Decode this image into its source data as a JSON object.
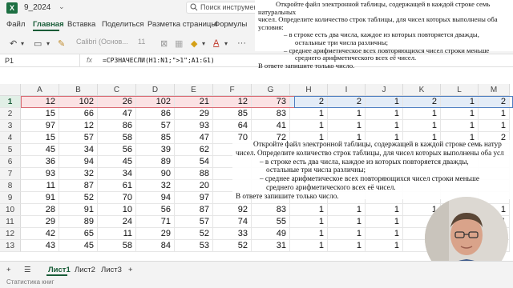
{
  "titlebar": {
    "app_icon": "X",
    "file_name": "9_2024",
    "search_placeholder": "Поиск инструмент"
  },
  "tabs": [
    "Файл",
    "Главная",
    "Вставка",
    "Поделиться",
    "Разметка страницы",
    "Формулы"
  ],
  "toolbar": {
    "font_name": "Calibri (Основ...",
    "font_size": "11"
  },
  "formula_bar": {
    "name_box": "P1",
    "fx": "fx",
    "formula": "=СРЗНАЧЕСЛИ(H1:N1;\">1\";A1:G1)"
  },
  "columns": [
    "A",
    "B",
    "C",
    "D",
    "E",
    "F",
    "G",
    "H",
    "I",
    "J",
    "K",
    "L",
    "M"
  ],
  "rows": [
    {
      "n": "1",
      "v": [
        "12",
        "102",
        "26",
        "102",
        "21",
        "12",
        "73",
        "2",
        "2",
        "1",
        "2",
        "1",
        "2"
      ]
    },
    {
      "n": "2",
      "v": [
        "15",
        "66",
        "47",
        "86",
        "29",
        "85",
        "83",
        "1",
        "1",
        "1",
        "1",
        "1",
        "1"
      ]
    },
    {
      "n": "3",
      "v": [
        "97",
        "12",
        "86",
        "57",
        "93",
        "64",
        "41",
        "1",
        "1",
        "1",
        "1",
        "1",
        "1"
      ]
    },
    {
      "n": "4",
      "v": [
        "15",
        "57",
        "58",
        "85",
        "47",
        "70",
        "72",
        "1",
        "1",
        "1",
        "1",
        "1",
        "2"
      ]
    },
    {
      "n": "5",
      "v": [
        "45",
        "34",
        "56",
        "39",
        "62",
        "",
        "",
        "",
        "",
        "",
        "",
        "",
        ""
      ]
    },
    {
      "n": "6",
      "v": [
        "36",
        "94",
        "45",
        "89",
        "54",
        "",
        "",
        "",
        "",
        "",
        "",
        "",
        ""
      ]
    },
    {
      "n": "7",
      "v": [
        "93",
        "32",
        "34",
        "90",
        "88",
        "",
        "",
        "",
        "",
        "",
        "",
        "",
        ""
      ]
    },
    {
      "n": "8",
      "v": [
        "11",
        "87",
        "61",
        "32",
        "20",
        "",
        "",
        "",
        "",
        "",
        "",
        "",
        ""
      ]
    },
    {
      "n": "9",
      "v": [
        "91",
        "52",
        "70",
        "94",
        "97",
        "",
        "",
        "",
        "",
        "",
        "",
        "",
        ""
      ]
    },
    {
      "n": "10",
      "v": [
        "28",
        "91",
        "10",
        "56",
        "87",
        "92",
        "83",
        "1",
        "1",
        "1",
        "1",
        "1",
        "1"
      ]
    },
    {
      "n": "11",
      "v": [
        "29",
        "89",
        "24",
        "71",
        "57",
        "74",
        "55",
        "1",
        "1",
        "1",
        "1",
        "1",
        "1"
      ]
    },
    {
      "n": "12",
      "v": [
        "42",
        "65",
        "11",
        "29",
        "52",
        "33",
        "49",
        "1",
        "1",
        "1",
        "1",
        "1",
        "1"
      ]
    },
    {
      "n": "13",
      "v": [
        "43",
        "45",
        "58",
        "84",
        "53",
        "52",
        "31",
        "1",
        "1",
        "1",
        "1",
        "1",
        "1"
      ]
    }
  ],
  "task_top": [
    "Откройте файл электронной таблицы, содержащей в каждой строке семь натуральных",
    "чисел. Определите количество строк таблицы, для чисел которых выполнены оба условия:",
    "– в строке есть два числа, каждое из которых повторяется дважды,",
    "остальные три числа различны;",
    "– среднее арифметическое всех повторяющихся чисел строки меньше",
    "среднего арифметического всех её чисел.",
    "В ответе запишите только число."
  ],
  "task_mid": [
    "Откройте файл электронной таблицы, содержащей в каждой строке семь натур",
    "чисел. Определите количество строк таблицы, для чисел которых выполнены оба усл",
    "– в строке есть два числа, каждое из которых повторяется дважды,",
    "остальные три числа различны;",
    "– среднее арифметическое всех повторяющихся чисел строки меньше",
    "среднего арифметического всех её чисел.",
    "В ответе запишите только число."
  ],
  "sheets": [
    "Лист1",
    "Лист2",
    "Лист3"
  ],
  "status": "Статистика книг"
}
